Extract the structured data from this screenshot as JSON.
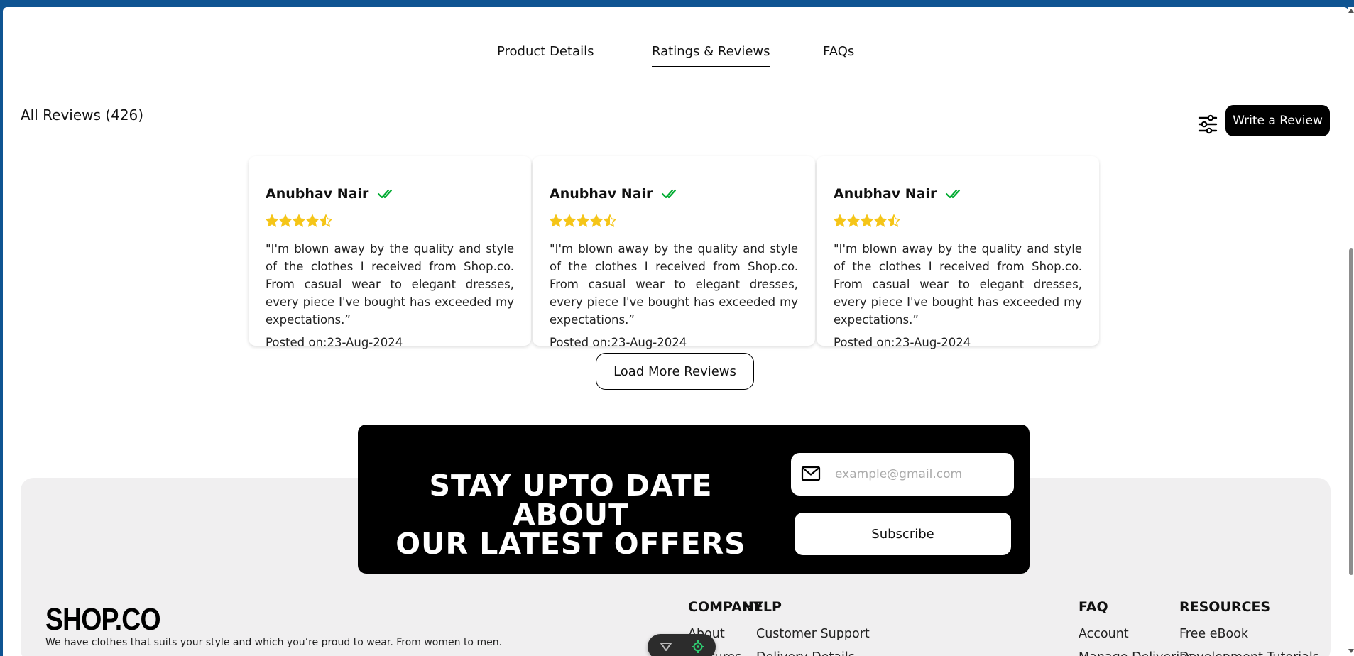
{
  "tabs": [
    {
      "label": "Product Details",
      "active": false
    },
    {
      "label": "Ratings & Reviews",
      "active": true
    },
    {
      "label": "FAQs",
      "active": false
    }
  ],
  "reviews": {
    "title": "All Reviews (426)",
    "write_label": "Write a Review",
    "load_more_label": "Load More Reviews",
    "items": [
      {
        "name": "Anubhav Nair",
        "rating": 4.5,
        "text": "\"I'm blown away by the quality and style of the clothes I received from Shop.co. From casual wear to elegant dresses, every piece I've bought has exceeded my expectations.”",
        "posted": "Posted on:23-Aug-2024"
      },
      {
        "name": "Anubhav Nair",
        "rating": 4.5,
        "text": "\"I'm blown away by the quality and style of the clothes I received from Shop.co. From casual wear to elegant dresses, every piece I've bought has exceeded my expectations.”",
        "posted": "Posted on:23-Aug-2024"
      },
      {
        "name": "Anubhav Nair",
        "rating": 4.5,
        "text": "\"I'm blown away by the quality and style of the clothes I received from Shop.co. From casual wear to elegant dresses, every piece I've bought has exceeded my expectations.”",
        "posted": "Posted on:23-Aug-2024"
      }
    ]
  },
  "newsletter": {
    "title_line1": "STAY UPTO DATE ABOUT",
    "title_line2": "OUR LATEST OFFERS",
    "email_placeholder": "example@gmail.com",
    "subscribe_label": "Subscribe"
  },
  "footer": {
    "brand": "SHOP.CO",
    "tagline": "We have clothes that suits your style and which you’re proud to wear. From women to men.",
    "columns": [
      {
        "heading": "COMPANY",
        "links": [
          "About",
          "Features"
        ]
      },
      {
        "heading": "HELP",
        "links": [
          "Customer Support",
          "Delivery Details"
        ]
      },
      {
        "heading": "FAQ",
        "links": [
          "Account",
          "Manage Deliveries"
        ]
      },
      {
        "heading": "RESOURCES",
        "links": [
          "Free eBook",
          "Development Tutorials"
        ]
      }
    ]
  },
  "colors": {
    "star": "#f5c518",
    "verified": "#01ab31",
    "browser_chrome": "#0f5492",
    "footer_bg": "#f0eff0"
  }
}
